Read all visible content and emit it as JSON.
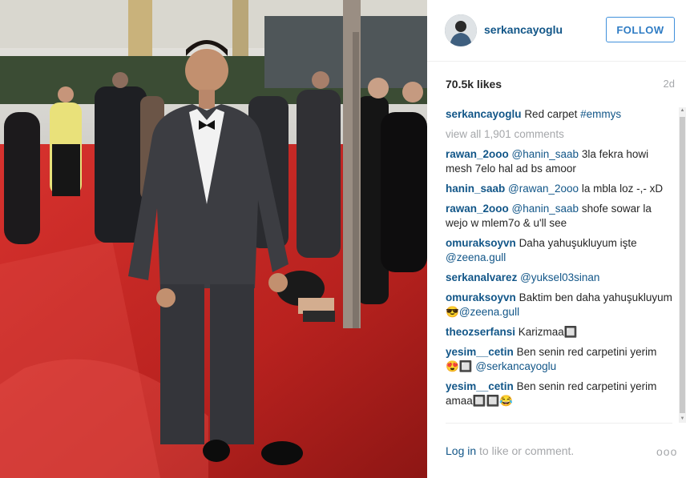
{
  "header": {
    "username": "serkancayoglu",
    "follow_label": "FOLLOW"
  },
  "stats": {
    "likes": "70.5k likes",
    "age": "2d"
  },
  "caption": {
    "author": "serkancayoglu",
    "text": "Red carpet",
    "hashtag": "#emmys"
  },
  "view_all": "view all 1,901 comments",
  "comments": [
    {
      "author": "rawan_2ooo",
      "mention": "@hanin_saab",
      "text": "3la fekra howi mesh 7elo hal ad bs amoor"
    },
    {
      "author": "hanin_saab",
      "mention": "@rawan_2ooo",
      "text": "la mbla loz -,- xD"
    },
    {
      "author": "rawan_2ooo",
      "mention": "@hanin_saab",
      "text": "shofe sowar la wejo w mlem7o & u'll see"
    },
    {
      "author": "omuraksoyvn",
      "text": "Daha yahuşukluyum işte",
      "mention_after": "@zeena.gull"
    },
    {
      "author": "serkanalvarez",
      "mention": "@yuksel03sinan",
      "text": ""
    },
    {
      "author": "omuraksoyvn",
      "text": "Baktim ben daha yahuşukluyum 😎",
      "mention_after": "@zeena.gull"
    },
    {
      "author": "theozserfansi",
      "text": "Karizmaa🔲"
    },
    {
      "author": "yesim__cetin",
      "text": "Ben senin red carpetini yerim 😍🔲",
      "mention_after": "@serkancayoglu"
    },
    {
      "author": "yesim__cetin",
      "text": "Ben senin red carpetini yerim amaa🔲🔲😂"
    }
  ],
  "footer": {
    "login_link": "Log in",
    "login_text": "to like or comment.",
    "more": "ooo"
  },
  "colors": {
    "link": "#125688",
    "muted": "#a5a7aa",
    "follow_border": "#4090db",
    "carpet": "#c42a27"
  },
  "icons": {
    "more": "ellipsis-icon"
  }
}
